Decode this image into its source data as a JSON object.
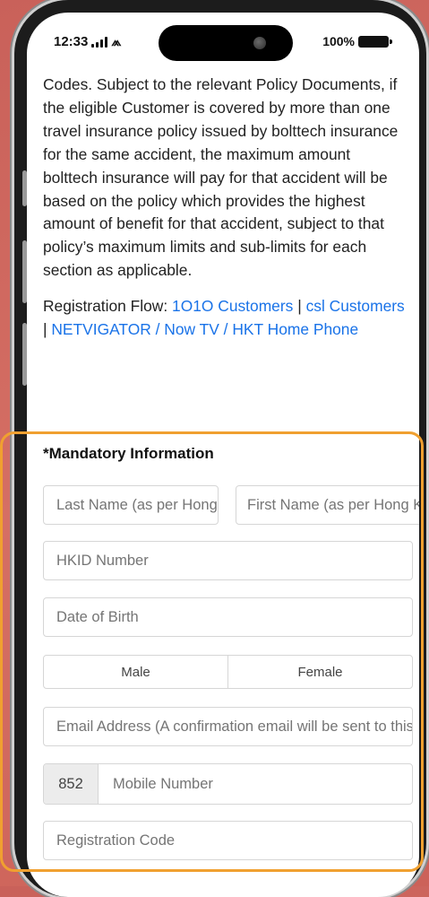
{
  "status_bar": {
    "time": "12:33",
    "battery": "100%"
  },
  "policy_text": "Codes. Subject to the relevant Policy Documents, if the eligible Customer is covered by more than one travel insurance policy issued by bolttech insurance for the same accident, the maximum amount bolttech insurance will pay for that accident will be based on the policy which provides the highest amount of benefit for that accident, subject to that policy’s maximum limits and sub-limits for each section as applicable.",
  "registration_flow": {
    "label": "Registration Flow:",
    "link_1010": "1O1O Customers",
    "separator_1": "|",
    "link_csl": "csl Customers",
    "separator_2": "|",
    "link_netvigator": "NETVIGATOR / Now TV / HKT Home Phone"
  },
  "form": {
    "title": "*Mandatory Information",
    "last_name_placeholder": "Last Name (as per Hong Kong ID Card)",
    "first_name_placeholder": "First Name (as per Hong Kong ID Card)",
    "hkid_placeholder": "HKID Number",
    "dob_placeholder": "Date of Birth",
    "gender_male": "Male",
    "gender_female": "Female",
    "email_placeholder": "Email Address (A confirmation email will be sent to this address)",
    "country_code": "852",
    "mobile_placeholder": "Mobile Number",
    "registration_code_placeholder": "Registration Code"
  },
  "colors": {
    "link": "#1a73e8",
    "highlight": "#f0a030",
    "background": "#d06860"
  }
}
